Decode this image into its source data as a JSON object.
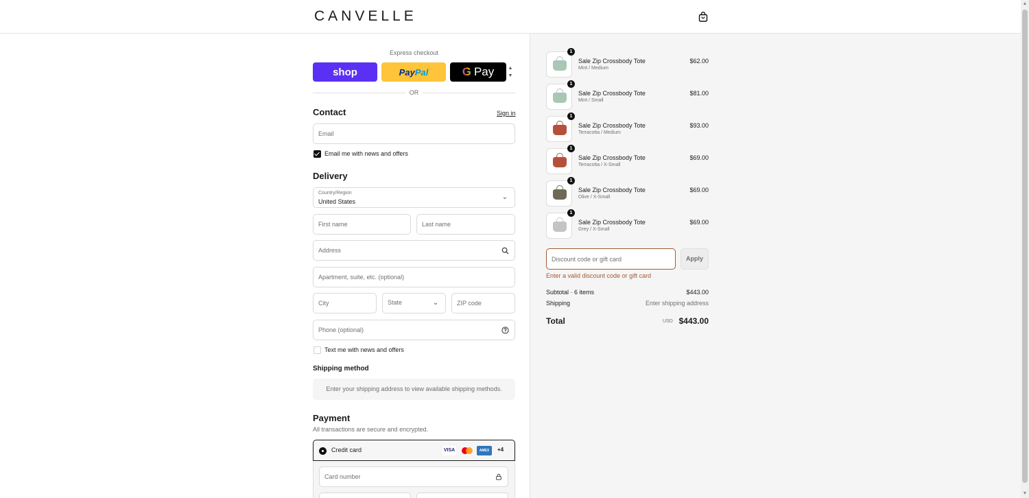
{
  "header": {
    "logo": "CANVELLE",
    "cart_icon": "shopping-bag-icon"
  },
  "express": {
    "label": "Express checkout",
    "shop_label": "shop",
    "paypal_label_1": "Pay",
    "paypal_label_2": "Pal",
    "gpay_g": "G",
    "gpay_label": "Pay",
    "or": "OR"
  },
  "contact": {
    "title": "Contact",
    "sign_in": "Sign in",
    "email_placeholder": "Email",
    "email_news_label": "Email me with news and offers",
    "email_news_checked": true
  },
  "delivery": {
    "title": "Delivery",
    "country_label": "Country/Region",
    "country_value": "United States",
    "first_name": "First name",
    "last_name": "Last name",
    "address": "Address",
    "apartment": "Apartment, suite, etc. (optional)",
    "city": "City",
    "state": "State",
    "zip": "ZIP code",
    "phone": "Phone (optional)",
    "text_news_label": "Text me with news and offers",
    "text_news_checked": false
  },
  "shipping_method": {
    "title": "Shipping method",
    "message": "Enter your shipping address to view available shipping methods."
  },
  "payment": {
    "title": "Payment",
    "subtitle": "All transactions are secure and encrypted.",
    "credit_card_label": "Credit card",
    "visa": "VISA",
    "amex": "AMEX",
    "more_cards": "+4",
    "card_number_placeholder": "Card number"
  },
  "summary": {
    "items": [
      {
        "name": "Sale Zip Crossbody Tote",
        "variant": "Mint / Medium",
        "price": "$62.00",
        "qty": "1",
        "color": "#a9c6b6"
      },
      {
        "name": "Sale Zip Crossbody Tote",
        "variant": "Mint / Small",
        "price": "$81.00",
        "qty": "1",
        "color": "#a9c6b6"
      },
      {
        "name": "Sale Zip Crossbody Tote",
        "variant": "Terracotta / Medium",
        "price": "$93.00",
        "qty": "1",
        "color": "#b5503c"
      },
      {
        "name": "Sale Zip Crossbody Tote",
        "variant": "Terracotta / X-Small",
        "price": "$69.00",
        "qty": "1",
        "color": "#b5503c"
      },
      {
        "name": "Sale Zip Crossbody Tote",
        "variant": "Olive / X-Small",
        "price": "$69.00",
        "qty": "1",
        "color": "#6f6a55"
      },
      {
        "name": "Sale Zip Crossbody Tote",
        "variant": "Grey / X-Small",
        "price": "$69.00",
        "qty": "1",
        "color": "#c4c4c4"
      }
    ],
    "discount_placeholder": "Discount code or gift card",
    "apply": "Apply",
    "discount_error": "Enter a valid discount code or gift card",
    "subtotal_label": "Subtotal · 6 items",
    "subtotal_value": "$443.00",
    "shipping_label": "Shipping",
    "shipping_value": "Enter shipping address",
    "total_label": "Total",
    "total_currency": "USD",
    "total_value": "$443.00"
  }
}
